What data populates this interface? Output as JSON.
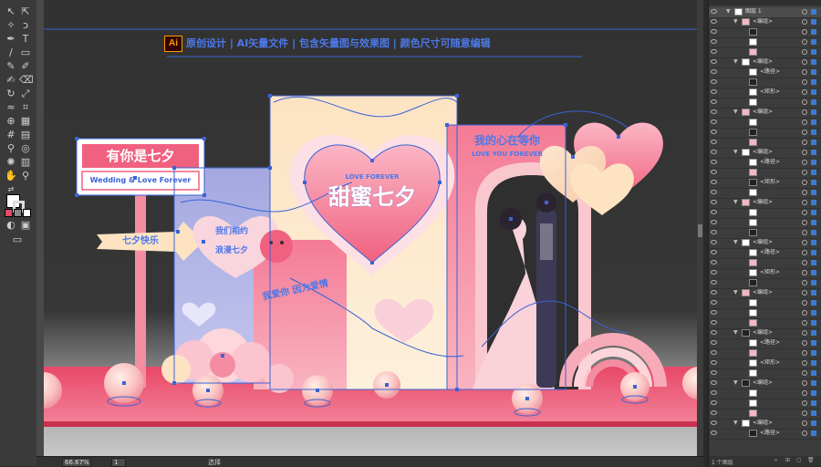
{
  "banner": {
    "ai_badge": "Ai",
    "text": "原创设计 | AI矢量文件 | 包含矢量图与效果图 | 颜色尺寸可随意编辑"
  },
  "sign": {
    "title": "有你是七夕",
    "subtitle": "Wedding & Love Forever"
  },
  "arrow_label": "七夕快乐",
  "heart_left_text": [
    "我们相约",
    "浪漫七夕"
  ],
  "main_heart_small": "LOVE FOREVER",
  "main_heart_title": "甜蜜七夕",
  "pink_panel_text": "我爱你 因为爱情",
  "right_panel_text": [
    "我的心在等你",
    "LOVE YOU FOREVER"
  ],
  "status": {
    "zoom": "66.67%",
    "artboard": "1",
    "mode": "选择"
  },
  "layers_panel": {
    "title": "图层",
    "layer_name": "图层 1",
    "group_label": "<编组>",
    "path_label": "<路径>",
    "rect_label": "<矩形>",
    "footer": "1 个图层"
  },
  "colors": {
    "selection": "#3a63d6",
    "pink": "#f0617f",
    "floor": "#e84866",
    "lavender": "#a9aee2",
    "cream": "#fde3c2"
  }
}
